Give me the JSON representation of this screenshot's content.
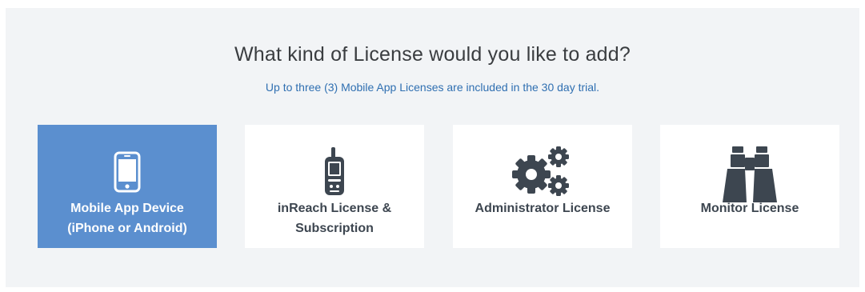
{
  "prompt": {
    "title": "What kind of License would you like to add?",
    "subtitle": "Up to three (3) Mobile App Licenses are included in the 30 day trial."
  },
  "license_options": [
    {
      "id": "mobile-app-device",
      "icon": "mobile-phone-icon",
      "label_lines": [
        "Mobile App Device",
        "(iPhone or Android)"
      ],
      "selected": true
    },
    {
      "id": "inreach-license",
      "icon": "gps-device-icon",
      "label_lines": [
        "inReach License &",
        "Subscription"
      ],
      "selected": false
    },
    {
      "id": "administrator-license",
      "icon": "gears-icon",
      "label_lines": [
        "Administrator License"
      ],
      "selected": false
    },
    {
      "id": "monitor-license",
      "icon": "binoculars-icon",
      "label_lines": [
        "Monitor License"
      ],
      "selected": false
    }
  ],
  "colors": {
    "panel_background": "#f2f4f6",
    "selected_card": "#5b8fcf",
    "card_background": "#ffffff",
    "icon_dark": "#3d4650",
    "subtitle_blue": "#2f6fb1"
  }
}
